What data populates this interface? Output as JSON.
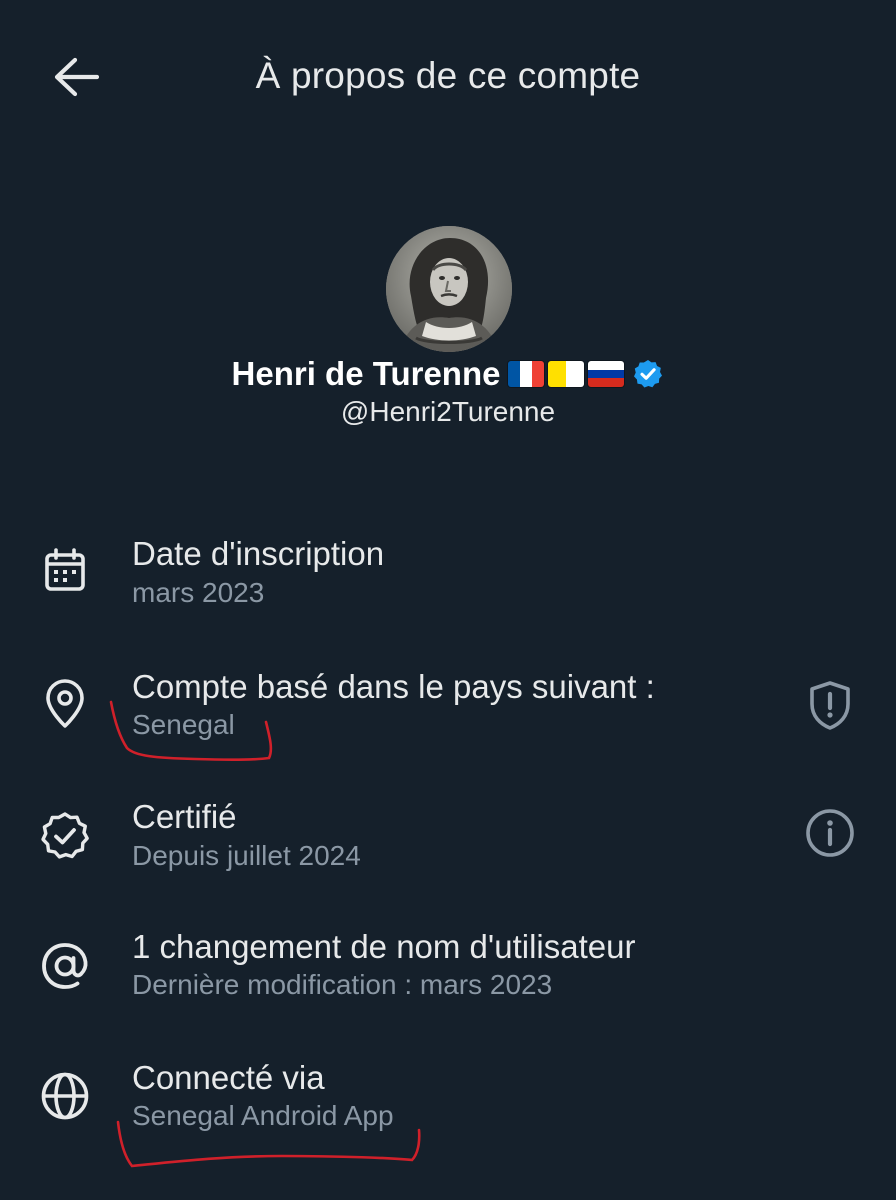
{
  "header": {
    "title": "À propos de ce compte",
    "back_icon": "arrow-left-icon"
  },
  "profile": {
    "name": "Henri de Turenne",
    "handle": "@Henri2Turenne",
    "flags": [
      "France",
      "Vatican City",
      "Russia"
    ],
    "verified": true,
    "verified_color": "#1d9bf0"
  },
  "details": [
    {
      "icon": "calendar-icon",
      "title": "Date d'inscription",
      "subtitle": "mars 2023"
    },
    {
      "icon": "location-pin-icon",
      "title": "Compte basé dans le pays suivant :",
      "subtitle": "Senegal",
      "action_icon": "shield-alert-icon"
    },
    {
      "icon": "verified-badge-icon",
      "title": "Certifié",
      "subtitle": "Depuis juillet 2024",
      "action_icon": "info-icon"
    },
    {
      "icon": "at-sign-icon",
      "title": "1 changement de nom d'utilisateur",
      "subtitle": "Dernière modification : mars 2023"
    },
    {
      "icon": "globe-icon",
      "title": "Connecté via",
      "subtitle": "Senegal Android App"
    }
  ],
  "colors": {
    "background": "#15202b",
    "primary_text": "#e7e9ea",
    "secondary_text": "#8b98a5",
    "annotation": "#d0202a"
  }
}
